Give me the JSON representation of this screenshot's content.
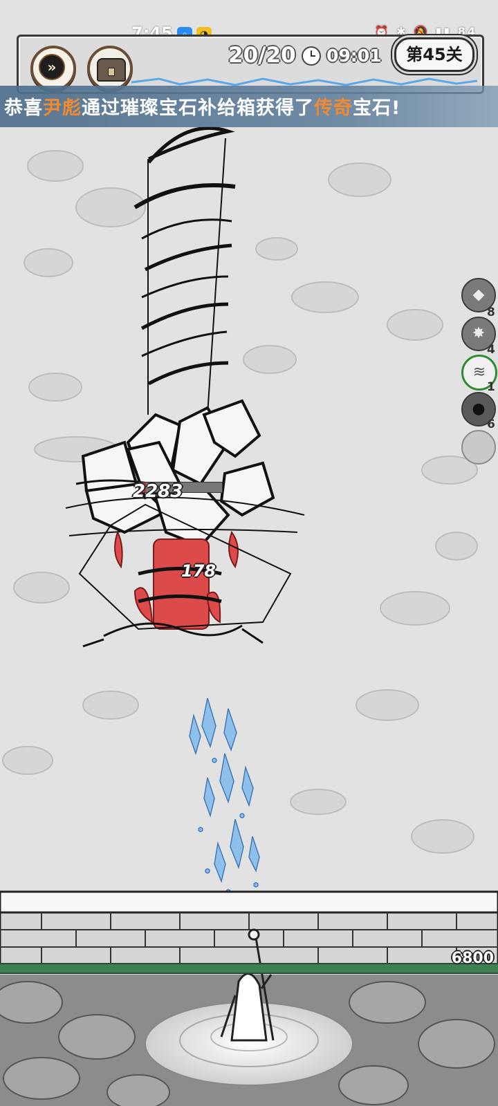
{
  "status_bar": {
    "time": "7:45",
    "app_icons": [
      "search-app-icon",
      "cat-app-icon"
    ],
    "right_indicators": "⏰ ✱ 🔕 ▮▮ 84"
  },
  "hud": {
    "fast_forward_icon": "fast-forward-icon",
    "chest_icon": "treasure-chest-icon",
    "wave_counter": "20/20",
    "timer": "09:01",
    "level": "第45关"
  },
  "banner": {
    "prefix": "恭喜",
    "player_name": "尹彪",
    "middle": "通过璀璨宝石补给箱获得了",
    "rarity": "传奇",
    "suffix": "宝石!"
  },
  "skills": [
    {
      "icon": "rock-skill-icon",
      "glyph": "◆",
      "count": "8"
    },
    {
      "icon": "crystal-burst-skill-icon",
      "glyph": "✸",
      "count": "4"
    },
    {
      "icon": "tornado-skill-icon",
      "glyph": "≋",
      "count": "1",
      "active": true
    },
    {
      "icon": "bomb-skill-icon",
      "glyph": "●",
      "count": "6"
    },
    {
      "icon": "empty-skill-slot",
      "glyph": "",
      "count": ""
    }
  ],
  "combat": {
    "damage_numbers": [
      "2283",
      "178"
    ],
    "enemy_hp_fraction": 0.08
  },
  "wall": {
    "hp": "6800",
    "hp_fraction": 1.0
  },
  "colors": {
    "banner_bg": "#567a9c",
    "highlight": "#f08a32",
    "wall_hp": "#3f7f52",
    "fire": "#d84848",
    "ice": "#5a9ad8"
  }
}
